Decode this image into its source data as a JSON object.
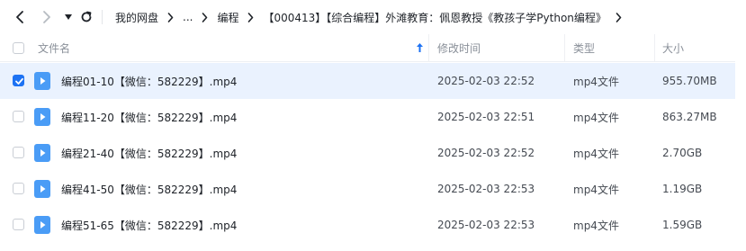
{
  "nav": {
    "back_icon": "chevron-left-icon",
    "forward_icon": "chevron-right-icon",
    "history_icon": "caret-down-icon",
    "refresh_icon": "refresh-icon"
  },
  "breadcrumb": {
    "items": [
      "我的网盘",
      "...",
      "编程",
      "【000413】【综合编程】外滩教育：佩恩教授《教孩子学Python编程》"
    ],
    "trailing_arrow": "chevron-right-icon"
  },
  "table": {
    "columns": {
      "name": "文件名",
      "modified": "修改时间",
      "type": "类型",
      "size": "大小"
    },
    "sort_icon": "sort-arrow-up-icon",
    "rows": [
      {
        "name": "编程01-10【微信：582229】.mp4",
        "modified": "2025-02-03 22:52",
        "type": "mp4文件",
        "size": "955.70MB",
        "selected": true
      },
      {
        "name": "编程11-20【微信：582229】.mp4",
        "modified": "2025-02-03 22:51",
        "type": "mp4文件",
        "size": "863.27MB",
        "selected": false
      },
      {
        "name": "编程21-40【微信：582229】.mp4",
        "modified": "2025-02-03 22:52",
        "type": "mp4文件",
        "size": "2.70GB",
        "selected": false
      },
      {
        "name": "编程41-50【微信：582229】.mp4",
        "modified": "2025-02-03 22:53",
        "type": "mp4文件",
        "size": "1.19GB",
        "selected": false
      },
      {
        "name": "编程51-65【微信：582229】.mp4",
        "modified": "2025-02-03 22:53",
        "type": "mp4文件",
        "size": "1.59GB",
        "selected": false
      }
    ]
  },
  "colors": {
    "accent": "#1d72f3",
    "selected_row": "#eaf2fe",
    "video_icon": "#4a9cf6"
  }
}
